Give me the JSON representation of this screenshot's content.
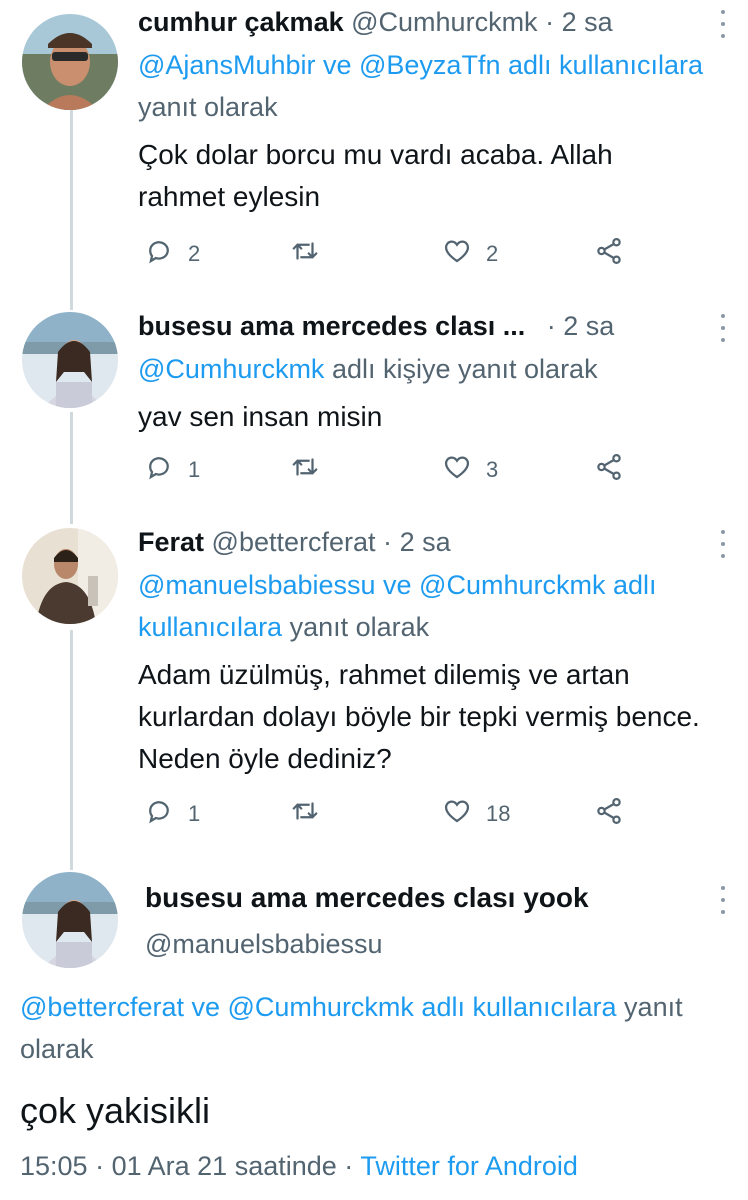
{
  "tweets": [
    {
      "name": "cumhur çakmak",
      "handle": "@Cumhurckmk",
      "time": "2 sa",
      "reply_mentions": "@AjansMuhbir ve @BeyzaTfn adlı kullanıcılara",
      "reply_suffix": "yanıt olarak",
      "text": "Çok dolar borcu mu vardı acaba. Allah rahmet eylesin",
      "replies": "2",
      "retweets": "",
      "likes": "2"
    },
    {
      "name": "busesu ama mercedes clası ...",
      "handle": "",
      "time": "2 sa",
      "reply_mentions": "@Cumhurckmk",
      "reply_suffix": "adlı kişiye yanıt olarak",
      "text": "yav sen insan misin",
      "replies": "1",
      "retweets": "",
      "likes": "3"
    },
    {
      "name": "Ferat",
      "handle": "@bettercferat",
      "time": "2 sa",
      "reply_mentions": "@manuelsbabiessu ve @Cumhurckmk adlı kullanıcılara",
      "reply_suffix": "yanıt olarak",
      "text": "Adam üzülmüş, rahmet dilemiş ve artan kurlardan dolayı böyle bir tepki vermiş bence. Neden öyle dediniz?",
      "replies": "1",
      "retweets": "",
      "likes": "18"
    }
  ],
  "main_tweet": {
    "name": "busesu ama mercedes clası yook",
    "handle": "@manuelsbabiessu",
    "reply_mentions": "@bettercferat ve @Cumhurckmk adlı kullanıcılara",
    "reply_suffix": "yanıt olarak",
    "text": "çok yakisikli",
    "time": "15:05",
    "date": "01 Ara 21 saatinde",
    "source": "Twitter for Android"
  },
  "icons": {
    "reply": "reply-icon",
    "retweet": "retweet-icon",
    "like": "heart-icon",
    "share": "share-icon",
    "more": "more-vertical-icon"
  },
  "colors": {
    "link": "#1d9bf0",
    "muted": "#536471",
    "text": "#0f1419",
    "thread_line": "#cfd9de"
  }
}
